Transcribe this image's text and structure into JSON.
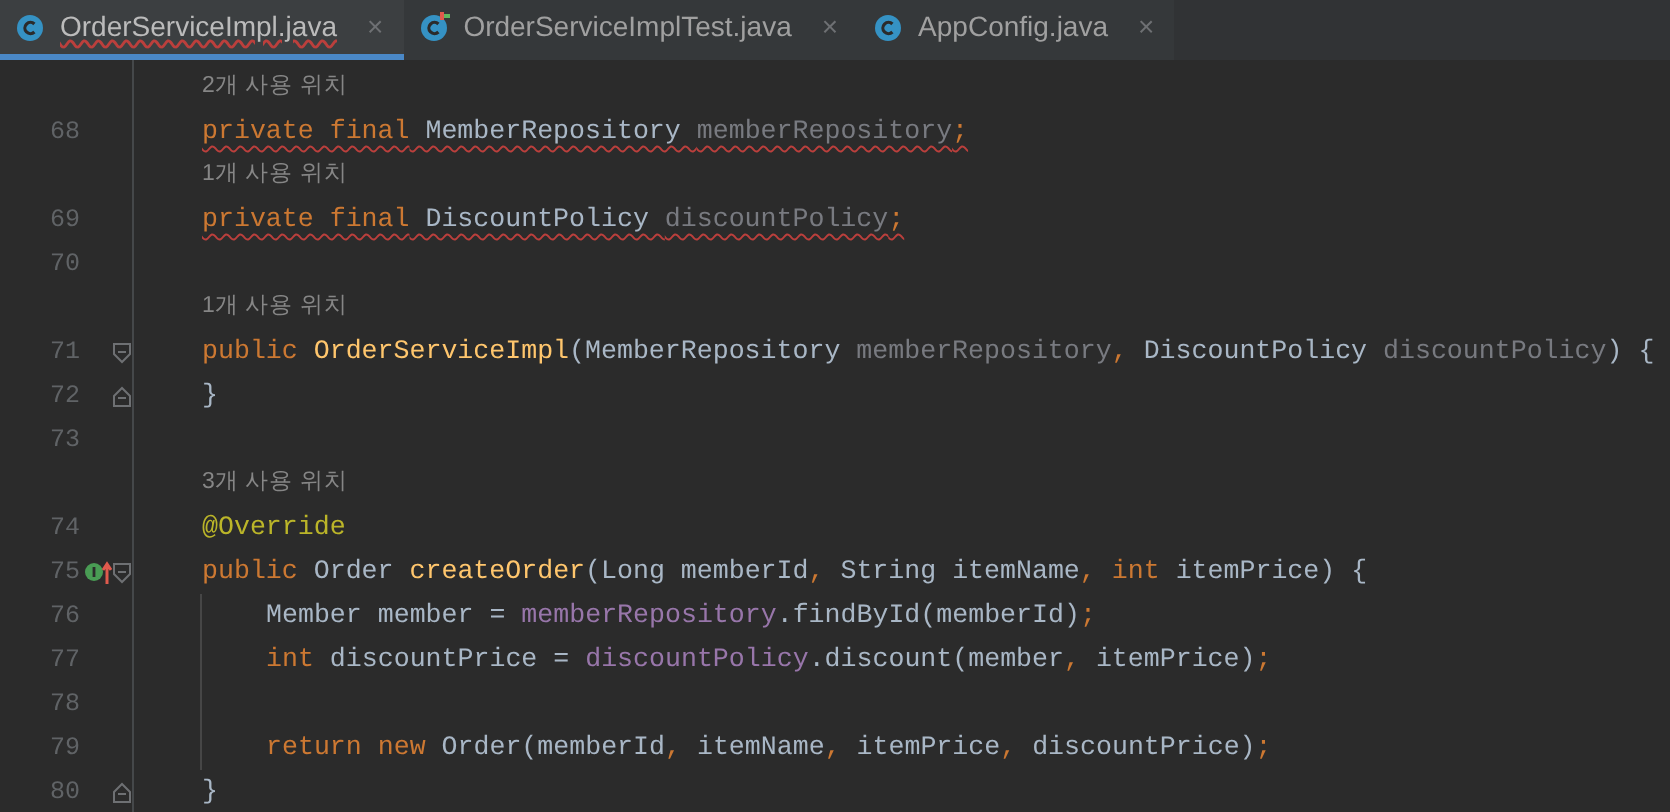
{
  "tabs": [
    {
      "label": "OrderServiceImpl.java",
      "close": "×",
      "selected": true,
      "error": true,
      "kind": "class"
    },
    {
      "label": "OrderServiceImplTest.java",
      "close": "×",
      "selected": false,
      "error": false,
      "kind": "test"
    },
    {
      "label": "AppConfig.java",
      "close": "×",
      "selected": false,
      "error": false,
      "kind": "class"
    }
  ],
  "rows": [
    {
      "kind": "hint",
      "text": "2개 사용 위치"
    },
    {
      "kind": "code",
      "number": "68",
      "warning": true,
      "inner": false,
      "fold_open": false,
      "fold_close": false,
      "implemented": false,
      "tokens": [
        {
          "kind": "keyword",
          "text": "private final"
        },
        {
          "kind": "plain",
          "text": " MemberRepository "
        },
        {
          "kind": "unused",
          "text": "memberRepository"
        },
        {
          "kind": "keyword",
          "text": ";"
        }
      ]
    },
    {
      "kind": "hint",
      "text": "1개 사용 위치"
    },
    {
      "kind": "code",
      "number": "69",
      "warning": true,
      "inner": false,
      "fold_open": false,
      "fold_close": false,
      "implemented": false,
      "tokens": [
        {
          "kind": "keyword",
          "text": "private final"
        },
        {
          "kind": "plain",
          "text": " DiscountPolicy "
        },
        {
          "kind": "unused",
          "text": "discountPolicy"
        },
        {
          "kind": "keyword",
          "text": ";"
        }
      ]
    },
    {
      "kind": "code",
      "number": "70",
      "inner": false,
      "fold_open": false,
      "fold_close": false,
      "implemented": false,
      "tokens": []
    },
    {
      "kind": "hint",
      "text": "1개 사용 위치"
    },
    {
      "kind": "code",
      "number": "71",
      "warning": false,
      "inner": false,
      "fold_open": true,
      "fold_close": false,
      "implemented": false,
      "tokens": [
        {
          "kind": "keyword",
          "text": "public "
        },
        {
          "kind": "method",
          "text": "OrderServiceImpl"
        },
        {
          "kind": "plain",
          "text": "(MemberRepository "
        },
        {
          "kind": "unused",
          "text": "memberRepository"
        },
        {
          "kind": "keyword",
          "text": ", "
        },
        {
          "kind": "plain",
          "text": "DiscountPolicy "
        },
        {
          "kind": "unused",
          "text": "discountPolicy"
        },
        {
          "kind": "plain",
          "text": ") {"
        }
      ]
    },
    {
      "kind": "code",
      "number": "72",
      "warning": false,
      "inner": false,
      "fold_open": false,
      "fold_close": true,
      "implemented": false,
      "tokens": [
        {
          "kind": "plain",
          "text": "}"
        }
      ]
    },
    {
      "kind": "code",
      "number": "73",
      "inner": false,
      "fold_open": false,
      "fold_close": false,
      "implemented": false,
      "tokens": []
    },
    {
      "kind": "hint",
      "text": "3개 사용 위치"
    },
    {
      "kind": "code",
      "number": "74",
      "warning": false,
      "inner": false,
      "fold_open": false,
      "fold_close": false,
      "implemented": false,
      "tokens": [
        {
          "kind": "annotation",
          "text": "@Override"
        }
      ]
    },
    {
      "kind": "code",
      "number": "75",
      "warning": false,
      "inner": false,
      "fold_open": true,
      "fold_close": false,
      "implemented": true,
      "tokens": [
        {
          "kind": "keyword",
          "text": "public "
        },
        {
          "kind": "plain",
          "text": "Order "
        },
        {
          "kind": "method",
          "text": "createOrder"
        },
        {
          "kind": "plain",
          "text": "(Long memberId"
        },
        {
          "kind": "keyword",
          "text": ", "
        },
        {
          "kind": "plain",
          "text": "String itemName"
        },
        {
          "kind": "keyword",
          "text": ", "
        },
        {
          "kind": "keyword",
          "text": "int "
        },
        {
          "kind": "plain",
          "text": "itemPrice) {"
        }
      ]
    },
    {
      "kind": "code",
      "number": "76",
      "warning": false,
      "inner": true,
      "fold_open": false,
      "fold_close": false,
      "implemented": false,
      "tokens": [
        {
          "kind": "plain",
          "text": "Member member = "
        },
        {
          "kind": "field",
          "text": "memberRepository"
        },
        {
          "kind": "plain",
          "text": ".findById(memberId)"
        },
        {
          "kind": "keyword",
          "text": ";"
        }
      ]
    },
    {
      "kind": "code",
      "number": "77",
      "warning": false,
      "inner": true,
      "fold_open": false,
      "fold_close": false,
      "implemented": false,
      "tokens": [
        {
          "kind": "keyword",
          "text": "int "
        },
        {
          "kind": "plain",
          "text": "discountPrice = "
        },
        {
          "kind": "field",
          "text": "discountPolicy"
        },
        {
          "kind": "plain",
          "text": ".discount(member"
        },
        {
          "kind": "keyword",
          "text": ", "
        },
        {
          "kind": "plain",
          "text": "itemPrice)"
        },
        {
          "kind": "keyword",
          "text": ";"
        }
      ]
    },
    {
      "kind": "code",
      "number": "78",
      "inner": true,
      "fold_open": false,
      "fold_close": false,
      "implemented": false,
      "tokens": []
    },
    {
      "kind": "code",
      "number": "79",
      "warning": false,
      "inner": true,
      "fold_open": false,
      "fold_close": false,
      "implemented": false,
      "tokens": [
        {
          "kind": "keyword",
          "text": "return new "
        },
        {
          "kind": "plain",
          "text": "Order(memberId"
        },
        {
          "kind": "keyword",
          "text": ", "
        },
        {
          "kind": "plain",
          "text": "itemName"
        },
        {
          "kind": "keyword",
          "text": ", "
        },
        {
          "kind": "plain",
          "text": "itemPrice"
        },
        {
          "kind": "keyword",
          "text": ", "
        },
        {
          "kind": "plain",
          "text": "discountPrice)"
        },
        {
          "kind": "keyword",
          "text": ";"
        }
      ]
    },
    {
      "kind": "code",
      "number": "80",
      "warning": false,
      "inner": false,
      "fold_open": false,
      "fold_close": true,
      "implemented": false,
      "tokens": [
        {
          "kind": "plain",
          "text": "}"
        }
      ]
    }
  ]
}
